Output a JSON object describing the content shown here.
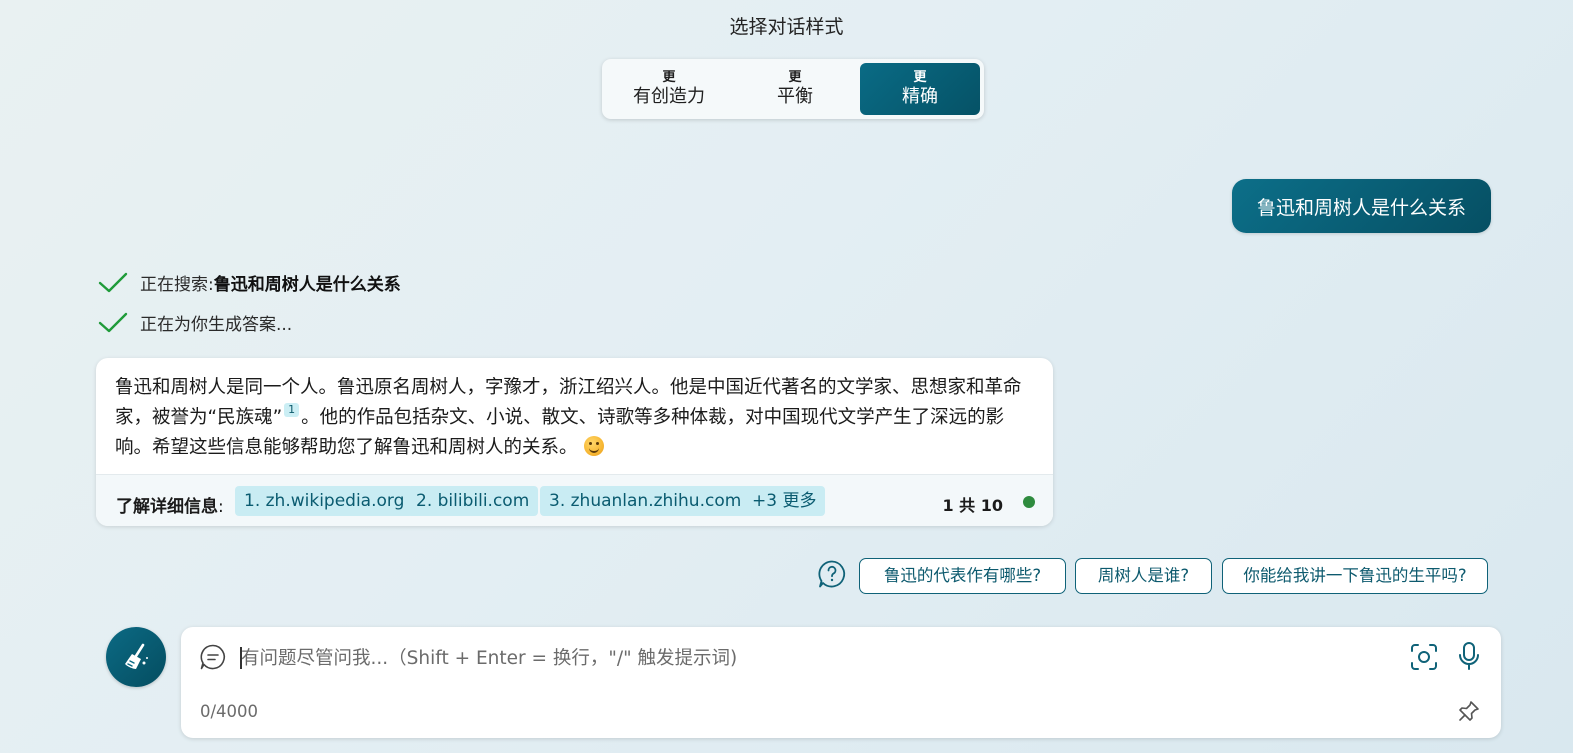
{
  "conversation_style": {
    "title": "选择对话样式",
    "options": [
      {
        "top": "更",
        "label": "有创造力",
        "selected": false
      },
      {
        "top": "更",
        "label": "平衡",
        "selected": false
      },
      {
        "top": "更",
        "label": "精确",
        "selected": true
      }
    ]
  },
  "user_message": "鲁迅和周树人是什么关系",
  "status": {
    "searching_prefix": "正在搜索: ",
    "searching_query": "鲁迅和周树人是什么关系",
    "generating": "正在为你生成答案..."
  },
  "answer": {
    "part1": "鲁迅和周树人是同一个人。鲁迅原名周树人，字豫才，浙江绍兴人。他是中国近代著名的文学家、思想家和革命家，被誉为“民族魂”",
    "citation": "1",
    "part2": "。他的作品包括杂文、小说、散文、诗歌等多种体裁，对中国现代文学产生了深远的影响。希望这些信息能够帮助您了解鲁迅和周树人的关系。",
    "emoji": "smiling-face-emoji"
  },
  "sources": {
    "label": "了解详细信息",
    "colon": ":",
    "links": [
      "1. zh.wikipedia.org",
      "2. bilibili.com",
      "3. zhuanlan.zhihu.com",
      "+3 更多"
    ],
    "page_count": "1 共 10",
    "status_color": "#2e8b3e"
  },
  "suggestions": [
    "鲁迅的代表作有哪些?",
    "周树人是谁?",
    "你能给我讲一下鲁迅的生平吗?"
  ],
  "input": {
    "placeholder": "有问题尽管问我...（Shift + Enter = 换行，\"/\" 触发提示词)",
    "value": "",
    "char_count": "0/4000"
  },
  "colors": {
    "accent": "#0a6b85",
    "accent_dark": "#055266",
    "citation_bg": "#c9ecf3",
    "check": "#1f9b3a"
  }
}
